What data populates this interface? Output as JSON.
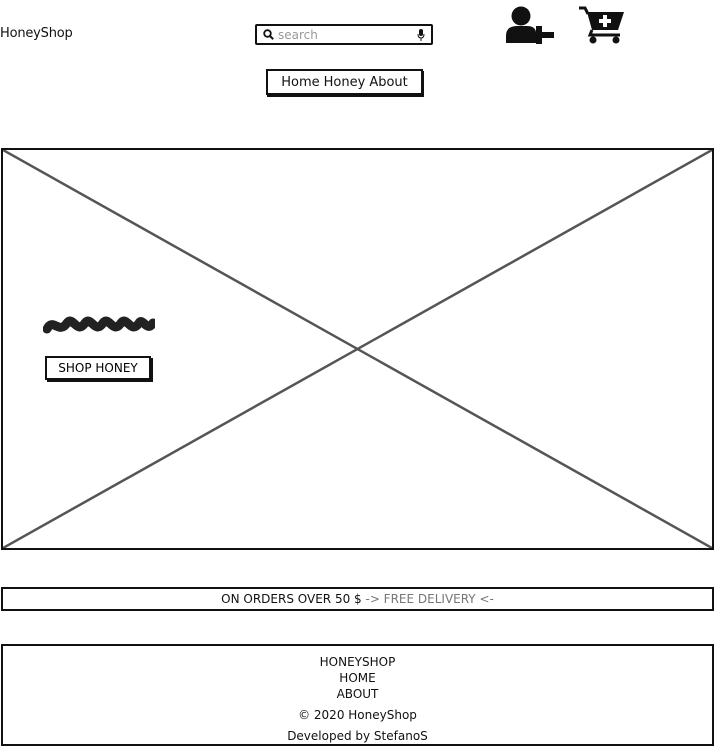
{
  "header": {
    "brand": "HoneyShop",
    "search": {
      "placeholder": "search",
      "value": ""
    },
    "icons": [
      "search-icon",
      "microphone-icon",
      "add-user-icon",
      "add-to-cart-icon"
    ]
  },
  "nav": {
    "items": [
      "Home",
      "Honey",
      "About"
    ]
  },
  "hero": {
    "button_label": "SHOP HONEY"
  },
  "banner": {
    "part1": "ON ORDERS OVER 50 $ ",
    "part2": "-> FREE DELIVERY <-"
  },
  "footer": {
    "links": [
      "HONEYSHOP",
      "HOME",
      "ABOUT"
    ],
    "copyright": "© 2020 HoneyShop",
    "developer": "Developed by StefanoS"
  },
  "colors": {
    "ink": "#111111",
    "muted": "#777777",
    "placeholder": "#999999"
  }
}
